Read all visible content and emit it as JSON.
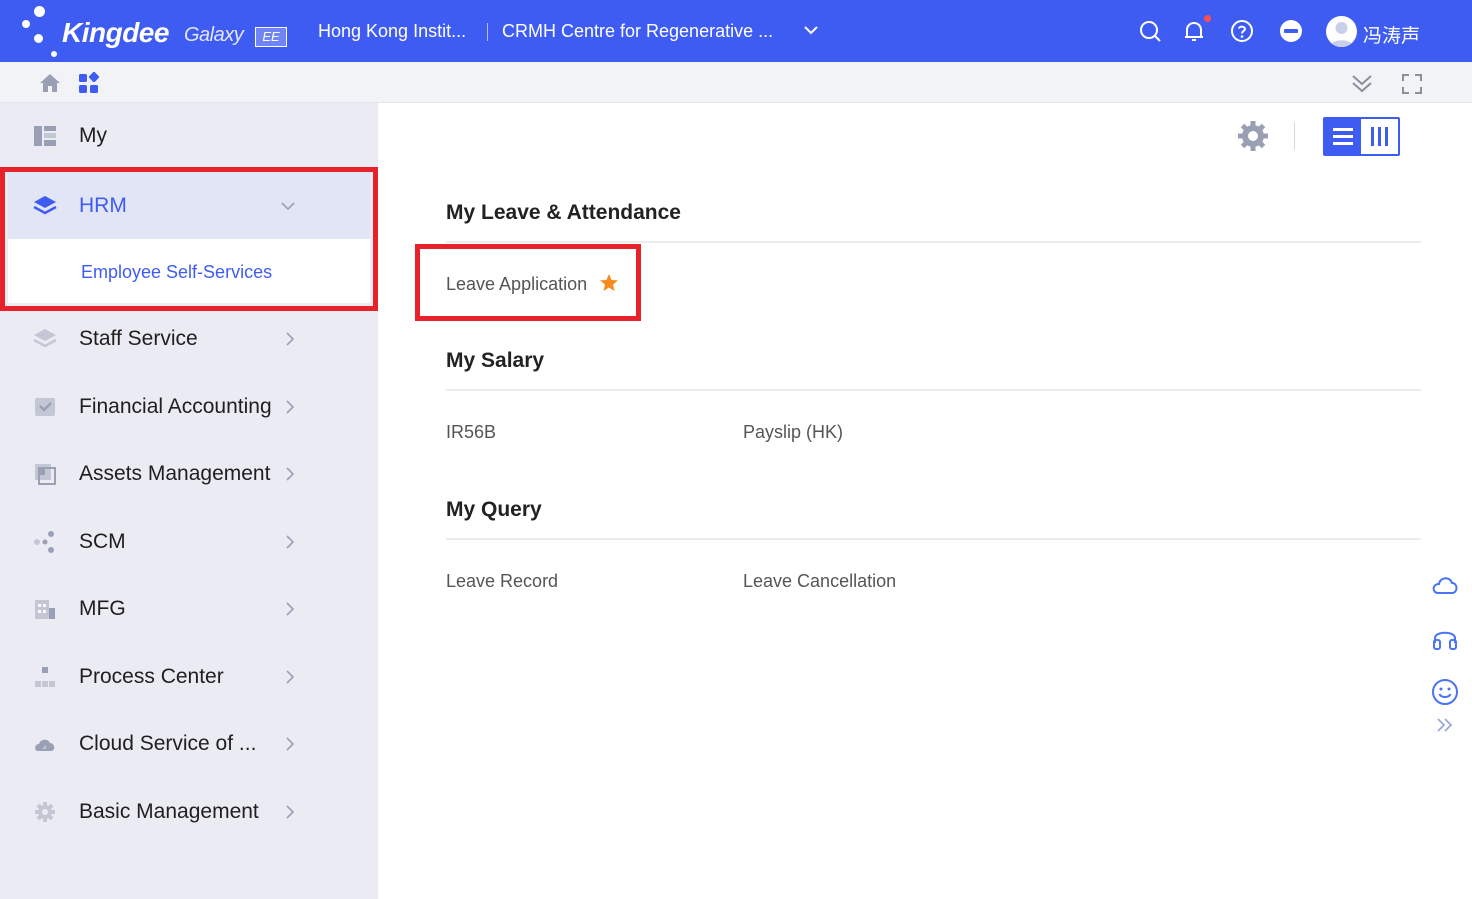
{
  "header": {
    "brand": "Kingdee",
    "brand_sub": "Galaxy",
    "brand_edition": "EE",
    "org": "Hong Kong Instit...",
    "dept": "CRMH Centre for Regenerative ...",
    "user_name": "冯涛声",
    "accent_color": "#3f5cf2"
  },
  "sidebar": {
    "items": [
      {
        "label": "My",
        "icon": "dashboard-icon"
      },
      {
        "label": "HRM",
        "icon": "layers-icon"
      },
      {
        "label": "Staff Service",
        "icon": "layers-icon"
      },
      {
        "label": "Financial Accounting",
        "icon": "checkbox-icon"
      },
      {
        "label": "Assets Management",
        "icon": "assets-icon"
      },
      {
        "label": "SCM",
        "icon": "network-icon"
      },
      {
        "label": "MFG",
        "icon": "building-icon"
      },
      {
        "label": "Process Center",
        "icon": "flow-icon"
      },
      {
        "label": "Cloud Service of ...",
        "icon": "cloud-icon"
      },
      {
        "label": "Basic Management",
        "icon": "gear-icon"
      }
    ],
    "hrm_sub": "Employee Self-Services"
  },
  "main": {
    "sections": [
      {
        "title": "My Leave & Attendance",
        "links": [
          "Leave Application"
        ]
      },
      {
        "title": "My Salary",
        "links": [
          "IR56B",
          "Payslip (HK)"
        ]
      },
      {
        "title": "My Query",
        "links": [
          "Leave Record",
          "Leave Cancellation"
        ]
      }
    ]
  },
  "highlight_color": "#e8222b"
}
